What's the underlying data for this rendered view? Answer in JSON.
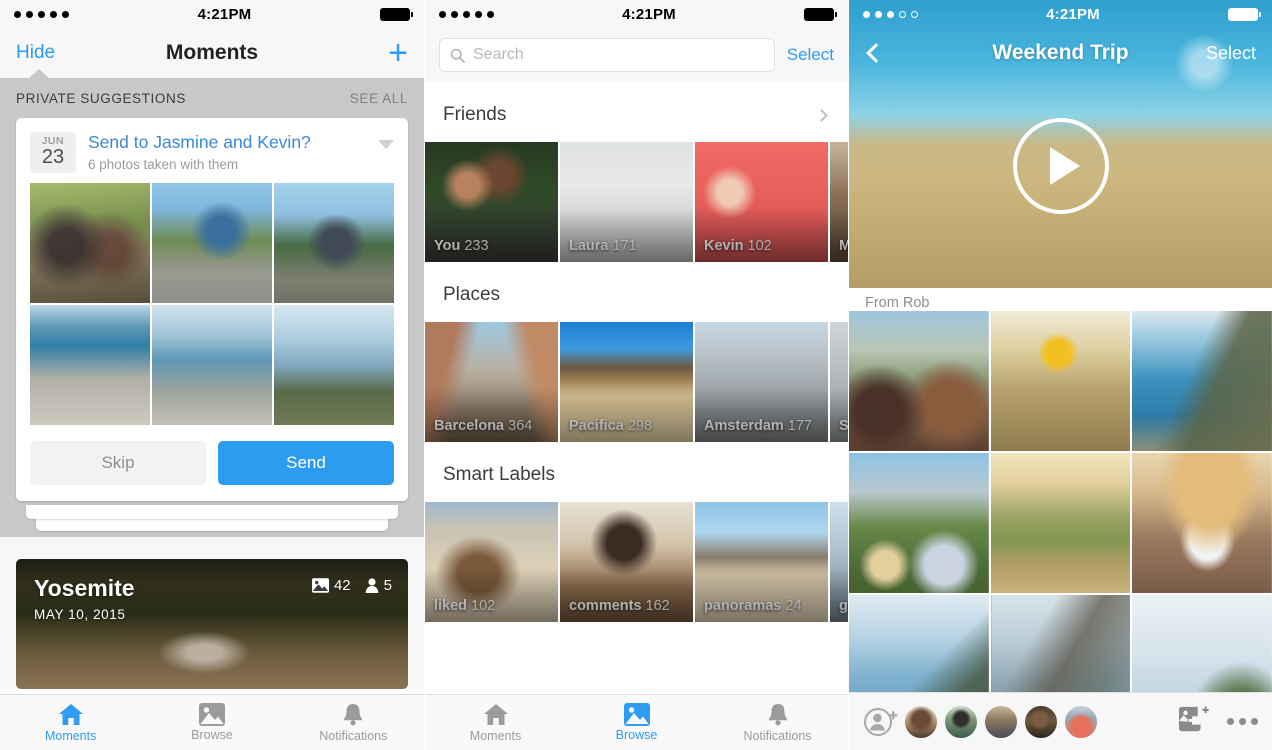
{
  "app": {
    "accent": "#2f9bf4",
    "name": "Moments"
  },
  "panel1": {
    "status": {
      "time": "4:21PM",
      "signal_dots": 5,
      "signal_filled": 5,
      "battery": 100
    },
    "nav": {
      "left_label": "Hide",
      "title": "Moments",
      "right_icon": "plus-icon"
    },
    "band": {
      "title": "PRIVATE SUGGESTIONS",
      "action": "SEE ALL"
    },
    "card": {
      "date_month": "JUN",
      "date_day": "23",
      "title": "Send to Jasmine and Kevin?",
      "subtitle": "6 photos taken with them",
      "collapse_icon": "chevron-down-icon",
      "photos": [
        "couple-sunglasses-selfie",
        "man-climbing-rock",
        "man-sitting-overlook",
        "lake-tahoe-rocky-shore",
        "lake-boulders-water",
        "pine-trees-lake-view"
      ],
      "skip_label": "Skip",
      "send_label": "Send"
    },
    "album": {
      "name": "Yosemite",
      "date": "MAY 10, 2015",
      "photo_count": "42",
      "people_count": "5",
      "photo_icon": "photo-icon",
      "people_icon": "person-icon"
    },
    "tabs": [
      {
        "label": "Moments",
        "icon": "home-icon",
        "active": true
      },
      {
        "label": "Browse",
        "icon": "photo-icon",
        "active": false
      },
      {
        "label": "Notifications",
        "icon": "bell-icon",
        "active": false
      }
    ]
  },
  "panel2": {
    "status": {
      "time": "4:21PM",
      "signal_dots": 5,
      "signal_filled": 5,
      "battery": 100
    },
    "search": {
      "placeholder": "Search",
      "icon": "search-icon"
    },
    "select_label": "Select",
    "sections": [
      {
        "title": "Friends",
        "has_chevron": true,
        "items": [
          {
            "label": "You",
            "count": "233"
          },
          {
            "label": "Laura",
            "count": "171"
          },
          {
            "label": "Kevin",
            "count": "102"
          },
          {
            "label": "Mo",
            "count": ""
          }
        ]
      },
      {
        "title": "Places",
        "has_chevron": false,
        "items": [
          {
            "label": "Barcelona",
            "count": "364"
          },
          {
            "label": "Pacifica",
            "count": "298"
          },
          {
            "label": "Amsterdam",
            "count": "177"
          },
          {
            "label": "Sa",
            "count": ""
          }
        ]
      },
      {
        "title": "Smart Labels",
        "has_chevron": false,
        "items": [
          {
            "label": "liked",
            "count": "102"
          },
          {
            "label": "comments",
            "count": "162"
          },
          {
            "label": "panoramas",
            "count": "24"
          },
          {
            "label": "gr",
            "count": ""
          }
        ]
      }
    ],
    "tabs": [
      {
        "label": "Moments",
        "icon": "home-icon",
        "active": false
      },
      {
        "label": "Browse",
        "icon": "photo-icon",
        "active": true
      },
      {
        "label": "Notifications",
        "icon": "bell-icon",
        "active": false
      }
    ]
  },
  "panel3": {
    "status": {
      "time": "4:21PM",
      "signal_dots": 5,
      "signal_filled": 3,
      "battery": 100
    },
    "nav": {
      "back_icon": "back-chevron-icon",
      "title": "Weekend Trip",
      "right_label": "Select"
    },
    "hero": {
      "play_icon": "play-icon",
      "caption": "windmill-prairie-video"
    },
    "from_label": "From Rob",
    "photos": [
      "couple-sunglasses-city-view",
      "sunflower-fence",
      "coastal-cliff-ocean",
      "couple-hats-hillside",
      "vineyard-path-sunset",
      "woman-straw-hat-sunglasses",
      "coast-cliff-sea",
      "big-sur-coastline",
      "ocean-horizon-trees"
    ],
    "facepile": {
      "add_icon": "add-person-icon",
      "avatars": [
        "rob",
        "laura",
        "kevin",
        "jasmine",
        "mo"
      ],
      "add_photo_icon": "add-photo-icon",
      "more_icon": "more-dots-icon"
    }
  }
}
